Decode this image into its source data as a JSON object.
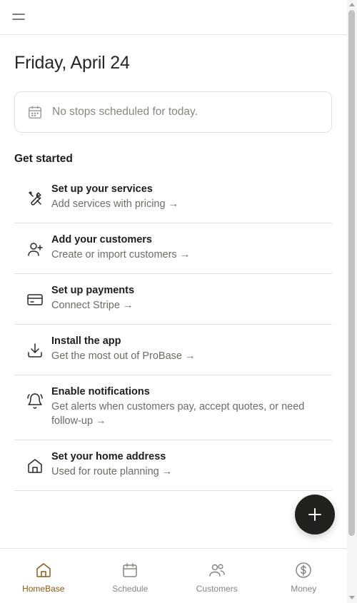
{
  "header": {
    "menu_icon": "menu-icon"
  },
  "date_heading": "Friday, April 24",
  "schedule_card": {
    "icon": "calendar-icon",
    "text": "No stops scheduled for today."
  },
  "get_started": {
    "title": "Get started",
    "items": [
      {
        "icon": "tools-icon",
        "title": "Set up your services",
        "subtitle": "Add services with pricing →"
      },
      {
        "icon": "add-user-icon",
        "title": "Add your customers",
        "subtitle": "Create or import customers →"
      },
      {
        "icon": "credit-card-icon",
        "title": "Set up payments",
        "subtitle": "Connect Stripe →"
      },
      {
        "icon": "download-icon",
        "title": "Install the app",
        "subtitle": "Get the most out of ProBase →"
      },
      {
        "icon": "bell-icon",
        "title": "Enable notifications",
        "subtitle": "Get alerts when customers pay, accept quotes, or need follow-up →"
      },
      {
        "icon": "home-icon",
        "title": "Set your home address",
        "subtitle": "Used for route planning →"
      }
    ]
  },
  "fab": {
    "icon": "plus-icon"
  },
  "bottom_nav": {
    "items": [
      {
        "icon": "home-icon",
        "label": "HomeBase",
        "active": true
      },
      {
        "icon": "calendar-icon",
        "label": "Schedule",
        "active": false
      },
      {
        "icon": "users-icon",
        "label": "Customers",
        "active": false
      },
      {
        "icon": "dollar-icon",
        "label": "Money",
        "active": false
      }
    ]
  },
  "colors": {
    "accent": "#8a5a12",
    "text": "#1f1d1a",
    "muted": "#6f6b65",
    "border": "#e3e1dd",
    "fab": "#23211e"
  }
}
